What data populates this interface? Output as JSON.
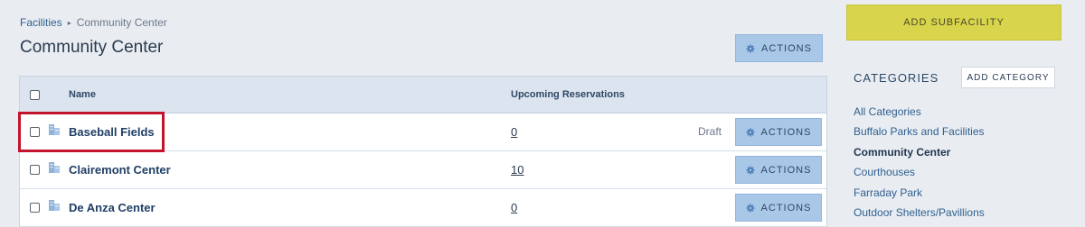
{
  "breadcrumb": {
    "link": "Facilities",
    "separator": "▸",
    "current": "Community Center"
  },
  "page_title": "Community Center",
  "header_actions_label": "ACTIONS",
  "table": {
    "columns": {
      "name": "Name",
      "reservations": "Upcoming Reservations"
    },
    "rows": [
      {
        "name": "Baseball Fields",
        "reservations": "0",
        "status": "Draft",
        "actions": "ACTIONS"
      },
      {
        "name": "Clairemont Center",
        "reservations": "10",
        "status": "",
        "actions": "ACTIONS"
      },
      {
        "name": "De Anza Center",
        "reservations": "0",
        "status": "",
        "actions": "ACTIONS"
      }
    ]
  },
  "sidebar": {
    "add_subfacility": "ADD SUBFACILITY",
    "categories_title": "CATEGORIES",
    "add_category": "ADD CATEGORY",
    "categories": [
      "All Categories",
      "Buffalo Parks and Facilities",
      "Community Center",
      "Courthouses",
      "Farraday Park",
      "Outdoor Shelters/Pavillions"
    ],
    "active_category": "Community Center"
  },
  "colors": {
    "accent_yellow": "#d8d44b",
    "action_blue": "#a9c8e8",
    "highlight_red": "#c3142d"
  },
  "icons": {
    "row_icon": "building-icon",
    "button_icon": "gear-icon"
  }
}
